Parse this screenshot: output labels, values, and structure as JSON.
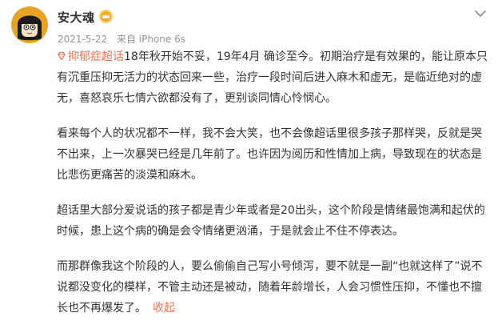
{
  "user": {
    "name": "安大魂",
    "avatar": "avatar-cartoon-face",
    "badge_icon": "gold-crown-badge-icon"
  },
  "meta": {
    "date": "2021-5-22",
    "source": "来自 iPhone 6s"
  },
  "post": {
    "topic": "抑郁症超话",
    "topic_icon": "diamond-icon",
    "paragraphs": [
      "18年秋开始不妥，19年4月 确诊至今。初期治疗是有效果的，能让原本只有沉重压抑无活力的状态回来一些，治疗一段时间后进入麻木和虚无，是临近绝对的虚无，喜怒哀乐七情六欲都没有了，更别谈同情心怜悯心。",
      "看来每个人的状况都不一样，我不会大笑，也不会像超话里很多孩子那样哭，反就是哭不出来，上一次暴哭已经是几年前了。也许因为阅历和性情加上病，导致现在的状态是比悲伤更痛苦的淡漠和麻木。",
      "超话里大部分爱说话的孩子都是青少年或者是20出头，这个阶段是情绪最饱满和起伏的时候，患上这个病的确是会令情绪更汹涌，于是就会止不住不停表达。",
      "而那群像我这个阶段的人，要么偷偷自己写小号倾泻，要不就是一副“也就这样了”说不说都没变化的模样，不管主动还是被动，随着年龄增长，人会习惯性压抑，不懂也不擅长也不再爆发了。"
    ],
    "collapse_label": "收起"
  },
  "colors": {
    "accent": "#eb7350",
    "text": "#333333",
    "meta": "#939393"
  },
  "icons": {
    "more": "chevron-down-icon"
  }
}
